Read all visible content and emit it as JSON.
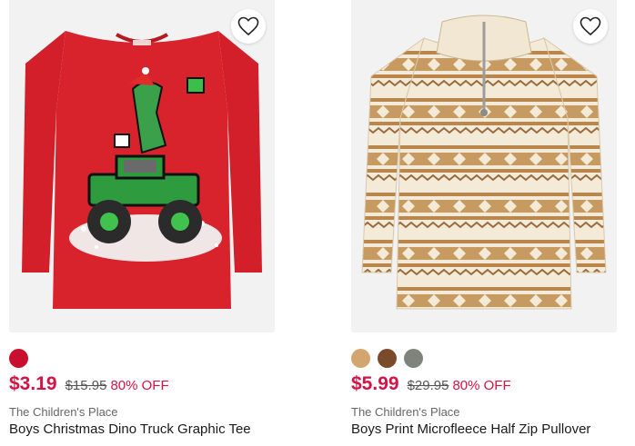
{
  "products": [
    {
      "image_alt": "Boys Christmas Dino Truck Graphic Tee",
      "swatches": [
        "#c8102e"
      ],
      "price": "$3.19",
      "was_price": "$15.95",
      "discount": "80% OFF",
      "brand": "The Children's Place",
      "title": "Boys Christmas Dino Truck Graphic Tee",
      "fav_icon": "heart-outline-icon"
    },
    {
      "image_alt": "Boys Print Microfleece Half Zip Pullover",
      "swatches": [
        "#d4a66f",
        "#7a4a2a",
        "#7f837c"
      ],
      "price": "$5.99",
      "was_price": "$29.95",
      "discount": "80% OFF",
      "brand": "The Children's Place",
      "title": "Boys Print Microfleece Half Zip Pullover",
      "fav_icon": "heart-outline-icon"
    }
  ],
  "colors": {
    "sale": "#d31245",
    "text": "#1a1a1a"
  }
}
